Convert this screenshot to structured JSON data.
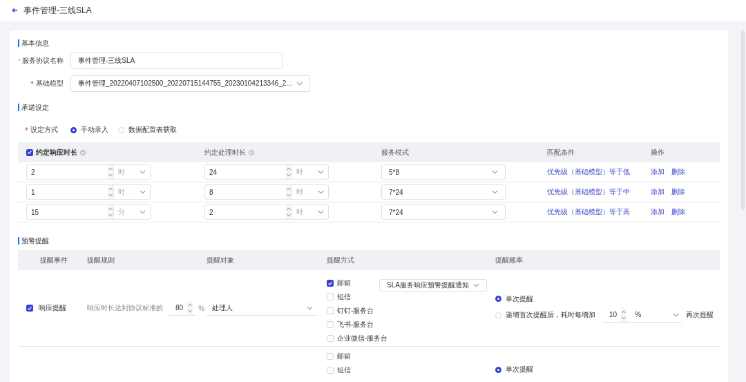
{
  "header": {
    "title": "事件管理-三线SLA"
  },
  "basic": {
    "title": "基本信息",
    "fields": [
      {
        "kind": "text",
        "label": "服务协议名称",
        "required": true,
        "value": "事件管理-三线SLA"
      },
      {
        "kind": "select",
        "label": "基础模型",
        "required": true,
        "value": "事件管理_20220407102500_20220715144755_20230104213346_2..."
      }
    ]
  },
  "commitment": {
    "title": "承诺设定",
    "method": {
      "label": "设定方式",
      "required": true,
      "options": [
        {
          "label": "手动录入",
          "selected": true
        },
        {
          "label": "数据配置表获取",
          "selected": false
        }
      ]
    },
    "columns": [
      {
        "kind": "check",
        "label": "约定响应时长",
        "checked": true
      },
      {
        "kind": "help",
        "label": "约定处理时长"
      },
      {
        "kind": "plain",
        "label": "服务模式"
      },
      {
        "kind": "plain",
        "label": "匹配条件"
      },
      {
        "kind": "plain",
        "label": "操作"
      }
    ],
    "rows": [
      {
        "response": {
          "value": "2",
          "unit": "时"
        },
        "handling": {
          "value": "24",
          "unit": "时"
        },
        "mode": "5*8",
        "condition": "优先级（基础模型）等于低",
        "actions": [
          "添加",
          "删除"
        ]
      },
      {
        "response": {
          "value": "1",
          "unit": "时"
        },
        "handling": {
          "value": "8",
          "unit": "时"
        },
        "mode": "7*24",
        "condition": "优先级（基础模型）等于中",
        "actions": [
          "添加",
          "删除"
        ]
      },
      {
        "response": {
          "value": "15",
          "unit": "分"
        },
        "handling": {
          "value": "2",
          "unit": "时"
        },
        "mode": "7*24",
        "condition": "优先级（基础模型）等于高",
        "actions": [
          "添加",
          "删除"
        ]
      }
    ]
  },
  "alerts": {
    "title": "预警提醒",
    "columns": [
      "提醒事件",
      "提醒规则",
      "提醒对象",
      "提醒方式",
      "提醒频率"
    ],
    "rows": [
      {
        "checked": true,
        "event": "响应提醒",
        "rule": "响应时长达到协议标准的",
        "percent": "80",
        "percent_unit": "%",
        "target": "处理人",
        "methods": [
          {
            "label": "邮箱",
            "checked": true
          },
          {
            "label": "短信",
            "checked": false
          },
          {
            "label": "钉钉-服务台",
            "checked": false
          },
          {
            "label": "飞书-服务台",
            "checked": false
          },
          {
            "label": "企业微信-服务台",
            "checked": false
          }
        ],
        "template": "SLA服务响应预警提醒通知",
        "frequency": [
          {
            "kind": "single",
            "label": "单次提醒",
            "selected": true
          },
          {
            "kind": "increment",
            "label": "递增首次提醒后，耗时每增加",
            "selected": false,
            "value": "10",
            "unit": "%",
            "suffix": "再次提醒"
          }
        ]
      },
      {
        "methods": [
          {
            "label": "邮箱",
            "checked": false
          },
          {
            "label": "短信",
            "checked": false
          }
        ],
        "frequency": [
          {
            "kind": "single",
            "label": "单次提醒",
            "selected": true
          }
        ]
      }
    ]
  }
}
